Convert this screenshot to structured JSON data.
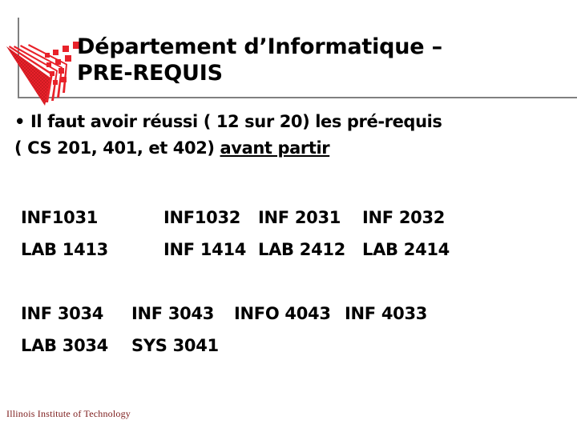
{
  "slide": {
    "background_color": "#ffffff",
    "rule_color": "#808080"
  },
  "logo": {
    "name": "iit-logo",
    "alt_text": "Illinois Institute of Technology logo",
    "primary_color": "#e8222a",
    "secondary_color": "#b4161b"
  },
  "header": {
    "title": "Département d’Informatique –\nPRE-REQUIS"
  },
  "body": {
    "bullet": {
      "marker": "•",
      "line1": "Il faut avoir réussi ( 12 sur 20) les pré-requis",
      "line2_plain": "( CS 201, 401, et 402) ",
      "line2_underlined": "avant partir"
    },
    "course_block_1": {
      "row1": [
        "INF1031",
        "INF1032",
        "INF 2031",
        "INF 2032"
      ],
      "row2": [
        "LAB 1413",
        "INF 1414",
        "LAB 2412",
        "LAB 2414"
      ]
    },
    "course_block_2": {
      "row1": [
        "INF 3034",
        "INF 3043",
        "INFO 4043",
        "INF 4033"
      ],
      "row2": [
        "LAB 3034",
        "SYS 3041"
      ]
    }
  },
  "footer": {
    "text": "Illinois Institute of Technology",
    "color": "#7b1a1a"
  }
}
